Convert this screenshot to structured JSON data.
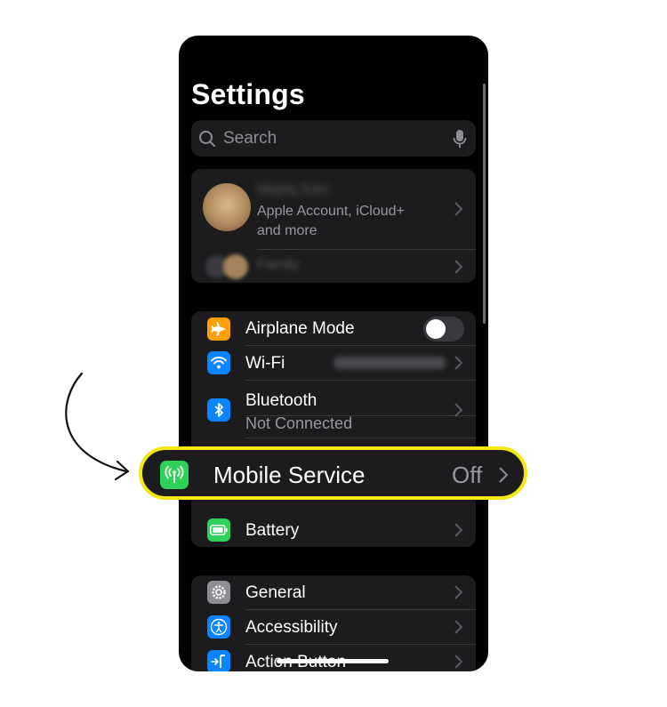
{
  "page": {
    "title": "Settings",
    "search_placeholder": "Search"
  },
  "account": {
    "name": "Maria Kim",
    "subtitle_line1": "Apple Account, iCloud+",
    "subtitle_line2": "and more",
    "family_label": "Family"
  },
  "connectivity": [
    {
      "label": "Airplane Mode",
      "icon": "airplane-icon",
      "color": "#ff9f0a",
      "toggle_on": false
    },
    {
      "label": "Wi-Fi",
      "icon": "wifi-icon",
      "color": "#0a84ff",
      "value": "",
      "value_blurred": true
    },
    {
      "label": "Bluetooth",
      "sub": "Not Connected",
      "icon": "bluetooth-icon",
      "color": "#0a84ff"
    },
    {
      "label": "Battery",
      "icon": "battery-icon",
      "color": "#30d158"
    }
  ],
  "general_group": [
    {
      "label": "General",
      "icon": "gear-icon",
      "color": "#8e8e93"
    },
    {
      "label": "Accessibility",
      "icon": "accessibility-icon",
      "color": "#0a84ff"
    },
    {
      "label": "Action Button",
      "icon": "action-button-icon",
      "color": "#0a84ff"
    }
  ],
  "highlight": {
    "label": "Mobile Service",
    "value": "Off",
    "icon": "antenna-icon",
    "color": "#30d158",
    "border_color": "#f5e614"
  }
}
